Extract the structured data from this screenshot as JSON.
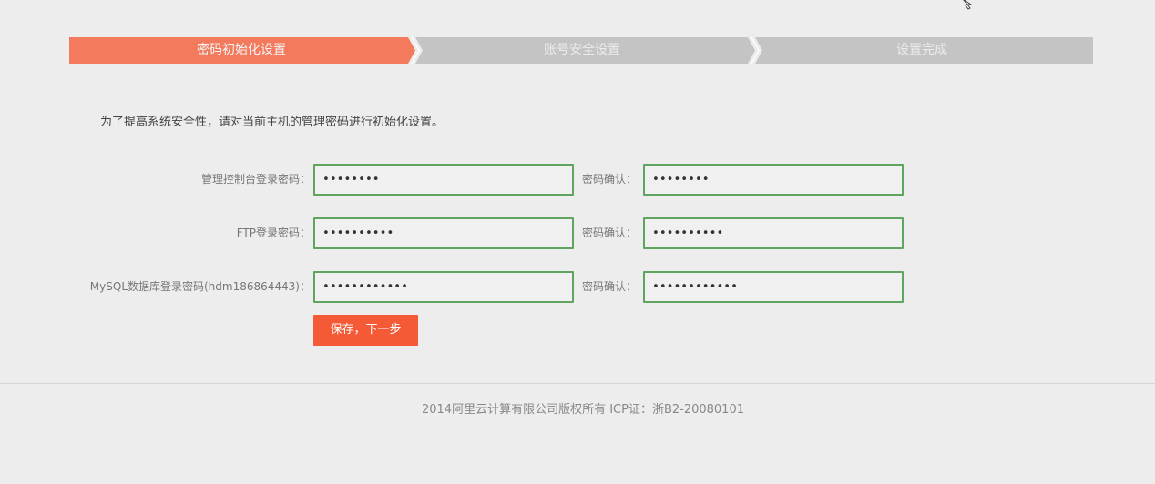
{
  "steps": [
    {
      "label": "密码初始化设置",
      "active": true
    },
    {
      "label": "账号安全设置",
      "active": false
    },
    {
      "label": "设置完成",
      "active": false
    }
  ],
  "colors": {
    "active_step": "#f37a5c",
    "inactive_step": "#c4c4c4",
    "input_border": "#5fa45f",
    "button": "#f35a35",
    "background": "#ededed"
  },
  "intro_text": "为了提高系统安全性，请对当前主机的管理密码进行初始化设置。",
  "form": {
    "rows": [
      {
        "label": "管理控制台登录密码：",
        "password_value": "••••••••",
        "confirm_label": "密码确认：",
        "confirm_value": "••••••••"
      },
      {
        "label": "FTP登录密码：",
        "password_value": "••••••••••",
        "confirm_label": "密码确认：",
        "confirm_value": "••••••••••"
      },
      {
        "label": "MySQL数据库登录密码(hdm186864443)：",
        "password_value": "••••••••••••",
        "confirm_label": "密码确认：",
        "confirm_value": "••••••••••••"
      }
    ],
    "save_label": "保存，下一步"
  },
  "footer": "2014阿里云计算有限公司版权所有 ICP证：浙B2-20080101",
  "icons": {
    "cursor": "mouse-pointer-icon"
  }
}
